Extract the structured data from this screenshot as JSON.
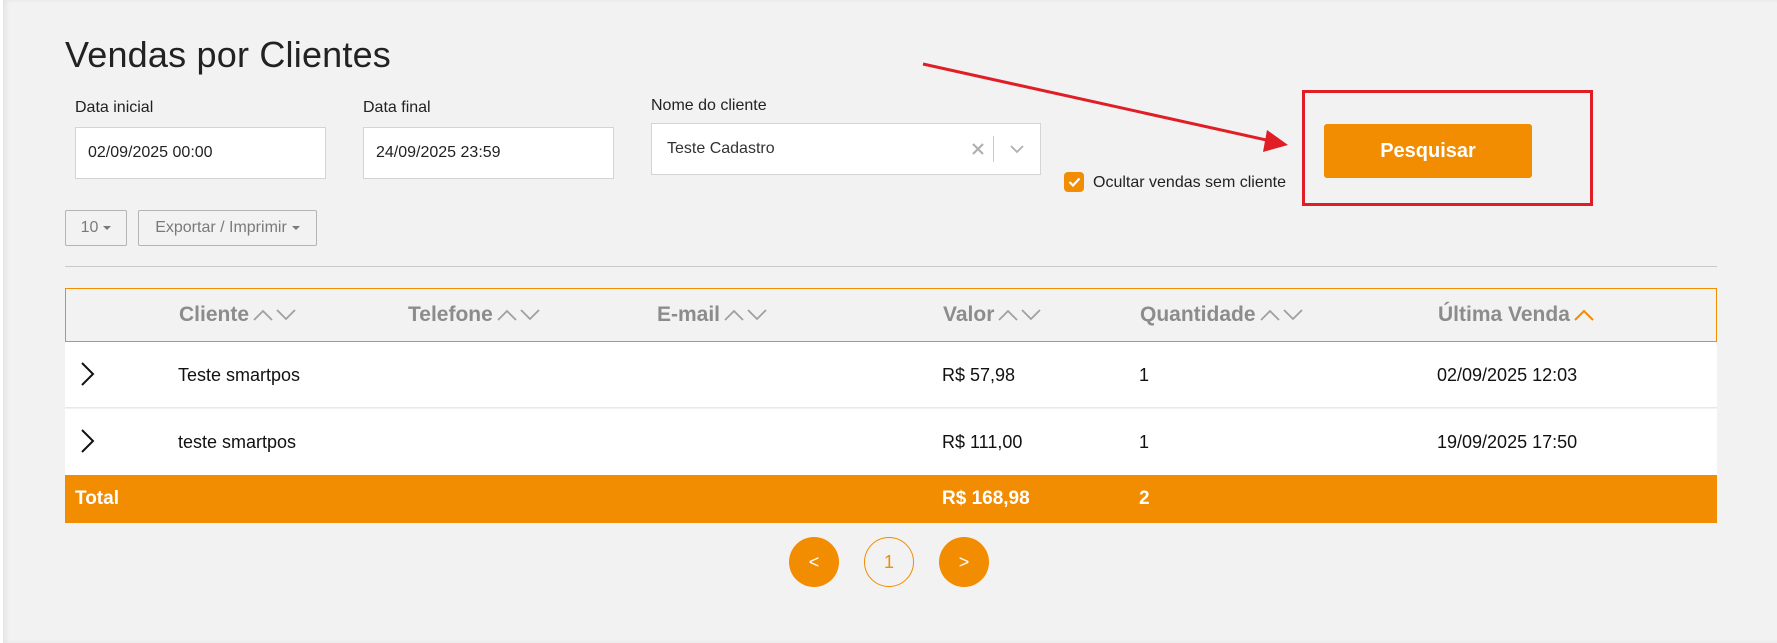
{
  "page": {
    "title": "Vendas por Clientes"
  },
  "filters": {
    "start_label": "Data inicial",
    "start_value": "02/09/2025 00:00",
    "end_label": "Data final",
    "end_value": "24/09/2025 23:59",
    "client_label": "Nome do cliente",
    "client_value": "Teste Cadastro",
    "hide_label": "Ocultar vendas sem cliente",
    "hide_checked": true,
    "search_label": "Pesquisar"
  },
  "toolbar": {
    "page_size": "10",
    "export_label": "Exportar / Imprimir"
  },
  "table": {
    "headers": [
      "Cliente",
      "Telefone",
      "E-mail",
      "Valor",
      "Quantidade",
      "Última Venda"
    ],
    "rows": [
      {
        "cliente": "Teste smartpos",
        "telefone": "",
        "email": "",
        "valor": "R$ 57,98",
        "quantidade": "1",
        "ultima": "02/09/2025 12:03"
      },
      {
        "cliente": "teste smartpos",
        "telefone": "",
        "email": "",
        "valor": "R$ 111,00",
        "quantidade": "1",
        "ultima": "19/09/2025 17:50"
      }
    ],
    "total": {
      "label": "Total",
      "valor": "R$ 168,98",
      "quantidade": "2"
    }
  },
  "pagination": {
    "prev": "<",
    "current": "1",
    "next": ">"
  },
  "colors": {
    "accent": "#f28c00",
    "annotation": "#e01e25",
    "header_text": "#8c8c8c"
  },
  "icons": [
    "chevron-right-icon",
    "sort-up-icon",
    "sort-down-icon",
    "clear-icon",
    "chevron-down-icon",
    "check-icon",
    "annotation-arrow"
  ]
}
